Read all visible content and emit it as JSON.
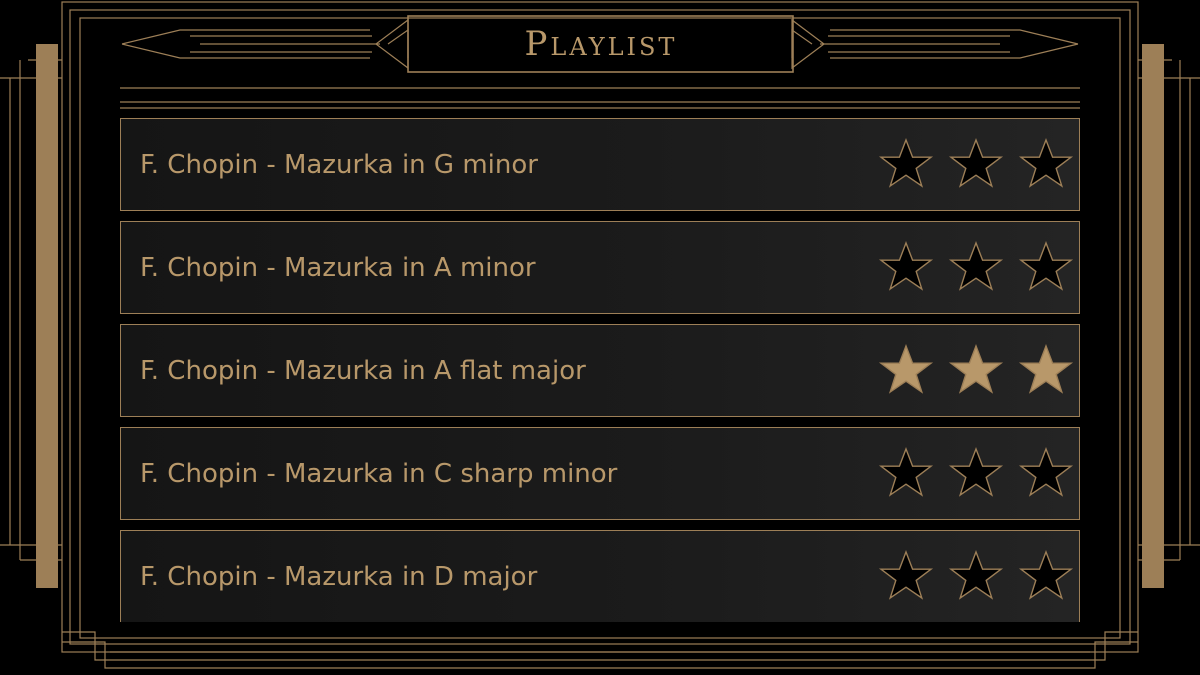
{
  "header": {
    "title": "Playlist"
  },
  "playlist": {
    "items": [
      {
        "title": "F. Chopin - Mazurka in G minor",
        "rating": 0,
        "max_rating": 3
      },
      {
        "title": "F. Chopin - Mazurka in A minor",
        "rating": 0,
        "max_rating": 3
      },
      {
        "title": "F. Chopin - Mazurka in A flat major",
        "rating": 3,
        "max_rating": 3
      },
      {
        "title": "F. Chopin - Mazurka in C sharp minor",
        "rating": 0,
        "max_rating": 3
      },
      {
        "title": "F. Chopin - Mazurka in D major",
        "rating": 0,
        "max_rating": 3
      }
    ]
  },
  "theme": {
    "gold": "#b8986a",
    "gold_dark": "#9d7f57",
    "background": "#000000",
    "row_dark": "#151515",
    "row_light": "#242424"
  },
  "icons": {
    "rating": "star-icon"
  }
}
